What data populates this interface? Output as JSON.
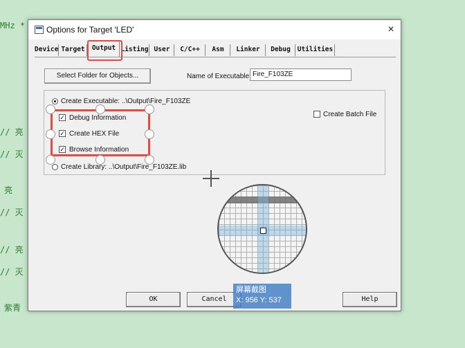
{
  "background_code": {
    "lines": [
      "MHz *",
      "// 亮",
      "// 灭",
      "亮",
      "// 灭",
      "// 亮",
      "// 灭",
      "紫青"
    ]
  },
  "dialog": {
    "title": "Options for Target 'LED'",
    "close_icon": "×",
    "tabs": [
      {
        "label": "Device"
      },
      {
        "label": "Target"
      },
      {
        "label": "Output"
      },
      {
        "label": "Listing"
      },
      {
        "label": "User"
      },
      {
        "label": "C/C++"
      },
      {
        "label": "Asm"
      },
      {
        "label": "Linker"
      },
      {
        "label": "Debug"
      },
      {
        "label": "Utilities"
      }
    ],
    "active_tab": "Output",
    "select_folder_button": "Select Folder for Objects...",
    "name_of_executable_label": "Name of Executable:",
    "name_of_executable_value": "Fire_F103ZE",
    "create_executable_label": "Create Executable:  ..\\Output\\Fire_F103ZE",
    "debug_information_label": "Debug Information",
    "create_hex_file_label": "Create HEX File",
    "browse_information_label": "Browse Information",
    "create_library_label": "Create Library:  ..\\Output\\Fire_F103ZE.lib",
    "create_batch_file_label": "Create Batch File",
    "check_mark": "✓",
    "buttons": {
      "ok": "OK",
      "cancel": "Cancel",
      "help": "Help"
    }
  },
  "screenshot_tool": {
    "label": "屏幕截图",
    "coords": "X: 956 Y: 537"
  },
  "colors": {
    "highlight": "#e44a3f",
    "background": "#c7e6cc"
  }
}
